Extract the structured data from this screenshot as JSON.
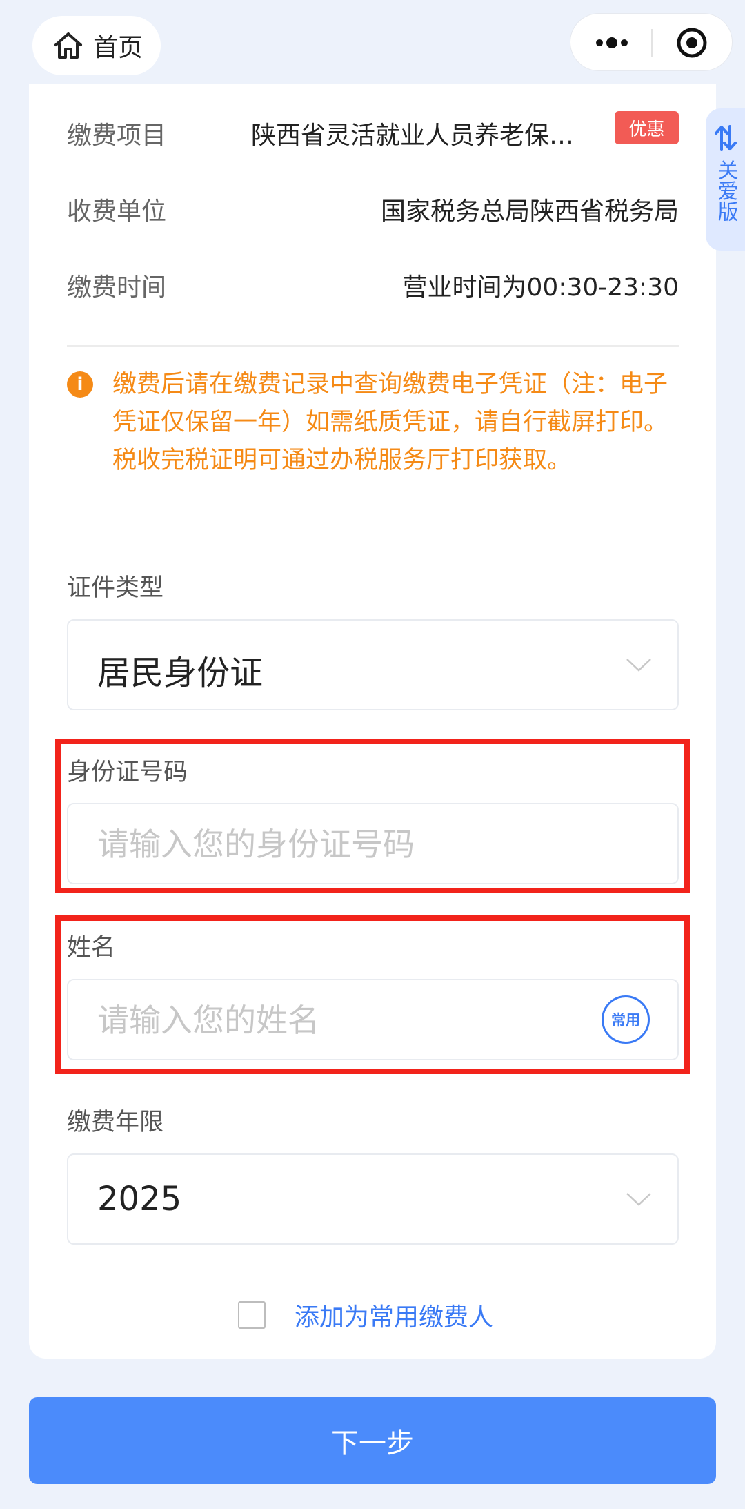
{
  "nav": {
    "home_label": "首页"
  },
  "care_version": {
    "label": "关爱版"
  },
  "payment_info": {
    "item_label": "缴费项目",
    "item_value": "陕西省灵活就业人员养老保…",
    "item_badge": "优惠",
    "payee_label": "收费单位",
    "payee_value": "国家税务总局陕西省税务局",
    "time_label": "缴费时间",
    "time_value": "营业时间为00:30-23:30"
  },
  "notice": {
    "text": "缴费后请在缴费记录中查询缴费电子凭证（注：电子凭证仅保留一年）如需纸质凭证，请自行截屏打印。税收完税证明可通过办税服务厅打印获取。"
  },
  "form": {
    "id_type_label": "证件类型",
    "id_type_value": "居民身份证",
    "id_number_label": "身份证号码",
    "id_number_placeholder": "请输入您的身份证号码",
    "name_label": "姓名",
    "name_placeholder": "请输入您的姓名",
    "name_common_button": "常用",
    "year_label": "缴费年限",
    "year_value": "2025",
    "add_common_payer": "添加为常用缴费人",
    "add_common_payer_checked": false
  },
  "actions": {
    "next_label": "下一步"
  },
  "colors": {
    "accent": "#4b8bfb",
    "notice": "#f58a16",
    "badge": "#f25b55",
    "highlight": "#f2231b"
  }
}
